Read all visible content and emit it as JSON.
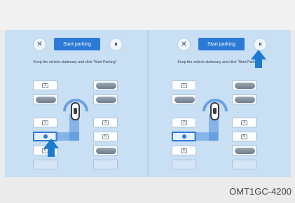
{
  "panels": [
    {
      "close_icon": "✕",
      "start_button": "Start parking",
      "info_icon": "⏸",
      "instruction": "Keep the vehicle stationary and click \"Start Parking\""
    },
    {
      "close_icon": "✕",
      "start_button": "Start parking",
      "info_icon": "⏸",
      "instruction": "Keep the vehicle stationary and click \"Start Parking\""
    }
  ],
  "slot_numbers": [
    "1",
    "2",
    "3",
    "5",
    "6"
  ],
  "colors": {
    "accent": "#2c79d6",
    "arrow": "#1a7bd1",
    "screen_bg": "#c9dff4"
  },
  "caption": "OMT1GC-4200"
}
